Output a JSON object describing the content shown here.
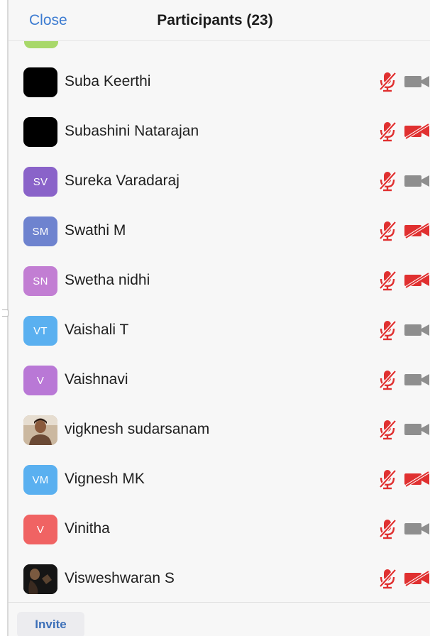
{
  "header": {
    "close_label": "Close",
    "title": "Participants (23)"
  },
  "participants": [
    {
      "name": "Suba Keerthi",
      "initials": "",
      "avatar": "black",
      "color": "#000000",
      "camera": "off-gray"
    },
    {
      "name": "Subashini Natarajan",
      "initials": "",
      "avatar": "black",
      "color": "#000000",
      "camera": "off-red"
    },
    {
      "name": "Sureka Varadaraj",
      "initials": "SV",
      "avatar": "initials",
      "color": "#8a63c9",
      "camera": "off-gray"
    },
    {
      "name": "Swathi M",
      "initials": "SM",
      "avatar": "initials",
      "color": "#6e83cf",
      "camera": "off-red"
    },
    {
      "name": "Swetha nidhi",
      "initials": "SN",
      "avatar": "initials",
      "color": "#c27ed3",
      "camera": "off-red"
    },
    {
      "name": "Vaishali T",
      "initials": "VT",
      "avatar": "initials",
      "color": "#5ab0f0",
      "camera": "off-gray"
    },
    {
      "name": "Vaishnavi",
      "initials": "V",
      "avatar": "initials",
      "color": "#b978d6",
      "camera": "off-gray"
    },
    {
      "name": "vigknesh sudarsanam",
      "initials": "",
      "avatar": "photo",
      "color": "#c8b39a",
      "camera": "off-gray"
    },
    {
      "name": "Vignesh MK",
      "initials": "VM",
      "avatar": "initials",
      "color": "#5ab0f0",
      "camera": "off-red"
    },
    {
      "name": "Vinitha",
      "initials": "V",
      "avatar": "initials",
      "color": "#f06363",
      "camera": "off-gray"
    },
    {
      "name": "Visweshwaran S",
      "initials": "",
      "avatar": "photo-dark",
      "color": "#1a1a1a",
      "camera": "off-red"
    }
  ],
  "footer": {
    "invite_label": "Invite"
  },
  "colors": {
    "accent": "#3c7bd1",
    "muted_red": "#e03030",
    "icon_gray": "#8e8e8e"
  }
}
